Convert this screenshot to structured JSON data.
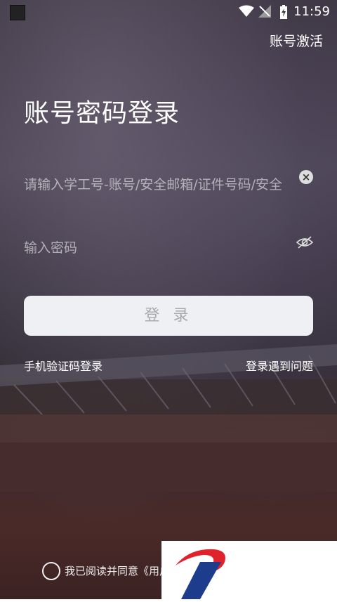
{
  "status_bar": {
    "time": "11:59"
  },
  "header": {
    "activate_label": "账号激活"
  },
  "page_title": "账号密码登录",
  "account_field": {
    "placeholder": "请输入学工号-账号/安全邮箱/证件号码/安全"
  },
  "password_field": {
    "placeholder": "输入密码"
  },
  "login_button_label": "登 录",
  "links": {
    "sms_login": "手机验证码登录",
    "trouble": "登录遇到问题"
  },
  "agreement": {
    "text": "我已阅读并同意《用户"
  },
  "colors": {
    "button_bg": "#eef0f3",
    "button_text": "#a7a9ae",
    "logo_red": "#e0232b",
    "logo_blue": "#1e3c8c"
  }
}
